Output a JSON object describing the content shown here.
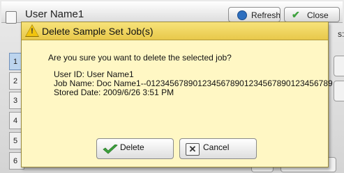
{
  "background": {
    "title": "User Name1",
    "refresh_label": "Refresh",
    "close_label": "Close",
    "right_label": "s:",
    "rows": [
      "1",
      "2",
      "3",
      "4",
      "5",
      "6"
    ]
  },
  "dialog": {
    "title": "Delete Sample Set Job(s)",
    "message": "Are you sure you want to delete the selected job?",
    "user_id": "User ID: User Name1",
    "job_name": "Job Name: Doc Name1--0123456789012345678901234567890123456789",
    "stored_date": "Stored Date: 2009/6/26 3:51 PM",
    "delete_label": "Delete",
    "cancel_label": "Cancel"
  },
  "colors": {
    "dialog_bg": "#fff7c4",
    "titlebar": "#f0d560",
    "accent_green": "#3da13d"
  }
}
